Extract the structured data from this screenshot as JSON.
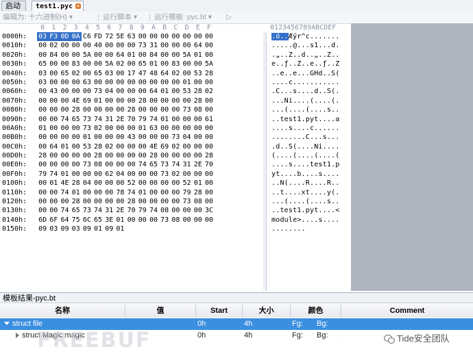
{
  "tabs": [
    {
      "label": "启动"
    },
    {
      "label": "test1.pyc",
      "close": "×"
    }
  ],
  "toolbar": {
    "edit_as": "编辑为: 十六进制(H) ▾",
    "run_script": "运行脚本 ▾",
    "run_template": "运行模板: pyc.bt ▾",
    "play": "▷"
  },
  "hex_columns": [
    "0",
    "1",
    "2",
    "3",
    "4",
    "5",
    "6",
    "7",
    "8",
    "9",
    "A",
    "B",
    "C",
    "D",
    "E",
    "F"
  ],
  "ascii_header": "0123456789ABCDEF",
  "rows": [
    {
      "addr": "0000h:",
      "hex": [
        "03",
        "F3",
        "0D",
        "0A",
        "C6",
        "FD",
        "72",
        "5E",
        "63",
        "00",
        "00",
        "00",
        "00",
        "00",
        "00",
        "00"
      ],
      "ascii": ".ó..Æýr^c......."
    },
    {
      "addr": "0010h:",
      "hex": [
        "00",
        "02",
        "00",
        "00",
        "00",
        "40",
        "00",
        "00",
        "00",
        "73",
        "31",
        "00",
        "00",
        "00",
        "64",
        "00"
      ],
      "ascii": ".....@...s1...d."
    },
    {
      "addr": "0020h:",
      "hex": [
        "00",
        "84",
        "00",
        "00",
        "5A",
        "00",
        "00",
        "64",
        "01",
        "00",
        "84",
        "00",
        "00",
        "5A",
        "01",
        "00"
      ],
      "ascii": ".„..Z..d..„..Z.."
    },
    {
      "addr": "0030h:",
      "hex": [
        "65",
        "00",
        "00",
        "83",
        "00",
        "00",
        "5A",
        "02",
        "00",
        "65",
        "01",
        "00",
        "83",
        "00",
        "00",
        "5A"
      ],
      "ascii": "e..ƒ..Z..e..ƒ..Z"
    },
    {
      "addr": "0040h:",
      "hex": [
        "03",
        "00",
        "65",
        "02",
        "00",
        "65",
        "03",
        "00",
        "17",
        "47",
        "48",
        "64",
        "02",
        "00",
        "53",
        "28"
      ],
      "ascii": "..e..e...GHd..S("
    },
    {
      "addr": "0050h:",
      "hex": [
        "03",
        "00",
        "00",
        "00",
        "63",
        "00",
        "00",
        "00",
        "00",
        "00",
        "00",
        "00",
        "00",
        "01",
        "00",
        "00"
      ],
      "ascii": "....c..........."
    },
    {
      "addr": "0060h:",
      "hex": [
        "00",
        "43",
        "00",
        "00",
        "00",
        "73",
        "04",
        "00",
        "00",
        "00",
        "64",
        "01",
        "00",
        "53",
        "28",
        "02"
      ],
      "ascii": ".C...s....d..S(."
    },
    {
      "addr": "0070h:",
      "hex": [
        "00",
        "00",
        "00",
        "4E",
        "69",
        "01",
        "00",
        "00",
        "00",
        "28",
        "00",
        "00",
        "00",
        "00",
        "28",
        "00"
      ],
      "ascii": "...Ni....(....(."
    },
    {
      "addr": "0080h:",
      "hex": [
        "00",
        "00",
        "00",
        "28",
        "00",
        "00",
        "00",
        "00",
        "28",
        "00",
        "00",
        "00",
        "00",
        "73",
        "08",
        "00"
      ],
      "ascii": "...(....(....s.."
    },
    {
      "addr": "0090h:",
      "hex": [
        "00",
        "00",
        "74",
        "65",
        "73",
        "74",
        "31",
        "2E",
        "70",
        "79",
        "74",
        "01",
        "00",
        "00",
        "00",
        "61"
      ],
      "ascii": "..test1.pyt....a"
    },
    {
      "addr": "00A0h:",
      "hex": [
        "01",
        "00",
        "00",
        "00",
        "73",
        "02",
        "00",
        "00",
        "00",
        "01",
        "63",
        "00",
        "00",
        "00",
        "00",
        "00"
      ],
      "ascii": "....s....c......"
    },
    {
      "addr": "00B0h:",
      "hex": [
        "00",
        "00",
        "00",
        "00",
        "01",
        "00",
        "00",
        "00",
        "43",
        "00",
        "00",
        "00",
        "73",
        "04",
        "00",
        "00"
      ],
      "ascii": "........C...s..."
    },
    {
      "addr": "00C0h:",
      "hex": [
        "00",
        "64",
        "01",
        "00",
        "53",
        "28",
        "02",
        "00",
        "00",
        "00",
        "4E",
        "69",
        "02",
        "00",
        "00",
        "00"
      ],
      "ascii": ".d..S(....Ni...."
    },
    {
      "addr": "00D0h:",
      "hex": [
        "28",
        "00",
        "00",
        "00",
        "00",
        "28",
        "00",
        "00",
        "00",
        "00",
        "28",
        "00",
        "00",
        "00",
        "00",
        "28"
      ],
      "ascii": "(....(....(....("
    },
    {
      "addr": "00E0h:",
      "hex": [
        "00",
        "00",
        "00",
        "00",
        "73",
        "08",
        "00",
        "00",
        "00",
        "74",
        "65",
        "73",
        "74",
        "31",
        "2E",
        "70"
      ],
      "ascii": "....s....test1.p"
    },
    {
      "addr": "00F0h:",
      "hex": [
        "79",
        "74",
        "01",
        "00",
        "00",
        "00",
        "62",
        "04",
        "00",
        "00",
        "00",
        "73",
        "02",
        "00",
        "00",
        "00"
      ],
      "ascii": "yt....b....s...."
    },
    {
      "addr": "0100h:",
      "hex": [
        "00",
        "01",
        "4E",
        "28",
        "04",
        "00",
        "00",
        "00",
        "52",
        "00",
        "00",
        "00",
        "00",
        "52",
        "01",
        "00"
      ],
      "ascii": "..N(....R....R.."
    },
    {
      "addr": "0110h:",
      "hex": [
        "00",
        "00",
        "74",
        "01",
        "00",
        "00",
        "00",
        "78",
        "74",
        "01",
        "00",
        "00",
        "00",
        "79",
        "28",
        "00"
      ],
      "ascii": "..t....xt....y(."
    },
    {
      "addr": "0120h:",
      "hex": [
        "00",
        "00",
        "00",
        "28",
        "00",
        "00",
        "00",
        "00",
        "28",
        "00",
        "00",
        "00",
        "00",
        "73",
        "08",
        "00"
      ],
      "ascii": "...(....(....s.."
    },
    {
      "addr": "0130h:",
      "hex": [
        "00",
        "00",
        "74",
        "65",
        "73",
        "74",
        "31",
        "2E",
        "70",
        "79",
        "74",
        "08",
        "00",
        "00",
        "00",
        "3C"
      ],
      "ascii": "..test1.pyt....<"
    },
    {
      "addr": "0140h:",
      "hex": [
        "6D",
        "6F",
        "64",
        "75",
        "6C",
        "65",
        "3E",
        "01",
        "00",
        "00",
        "00",
        "73",
        "08",
        "00",
        "00",
        "00"
      ],
      "ascii": "module>....s...."
    },
    {
      "addr": "0150h:",
      "hex": [
        "09",
        "03",
        "09",
        "03",
        "09",
        "01",
        "09",
        "01"
      ],
      "ascii": "........"
    }
  ],
  "results": {
    "title": "模板结果-pyc.bt",
    "headers": {
      "name": "名称",
      "value": "值",
      "start": "Start",
      "size": "大小",
      "color": "颜色",
      "comment": "Comment"
    },
    "rows": [
      {
        "name": "struct file",
        "value": "",
        "start": "0h",
        "size": "4h",
        "fg": "Fg:",
        "bg": "Bg:",
        "comment": ""
      },
      {
        "name": "struct Magic magic",
        "value": "",
        "start": "0h",
        "size": "4h",
        "fg": "Fg:",
        "bg": "Bg:",
        "comment": ""
      }
    ]
  },
  "watermarks": {
    "freebuf": "FREEBUF",
    "tide": "Tide安全团队"
  },
  "colors": {
    "selection": "#3470c9",
    "row_selected": "#3b8fe0",
    "highlight_row": "#fff8b8"
  }
}
